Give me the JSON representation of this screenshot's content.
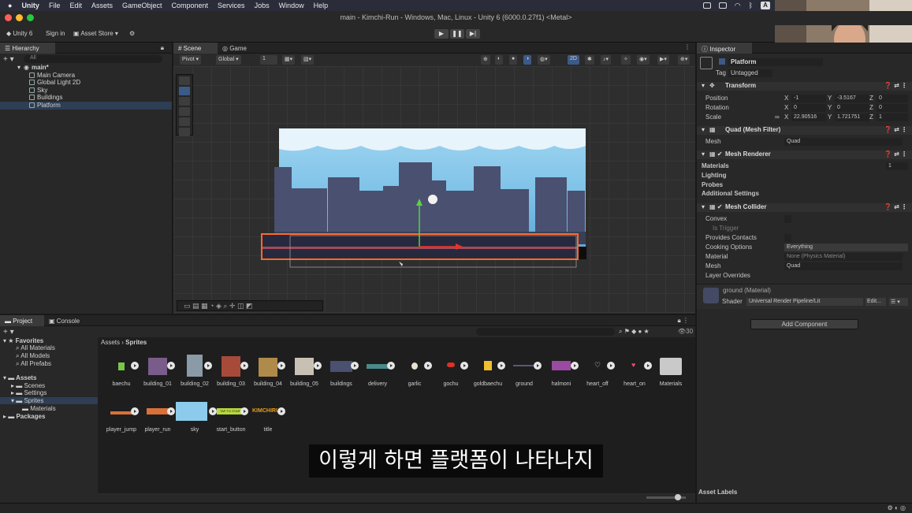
{
  "menubar": {
    "app": "Unity",
    "items": [
      "File",
      "Edit",
      "Assets",
      "GameObject",
      "Component",
      "Services",
      "Jobs",
      "Window",
      "Help"
    ],
    "badge": "A"
  },
  "window": {
    "title": "main - Kimchi-Run - Windows, Mac, Linux - Unity 6 (6000.0.27f1) <Metal>"
  },
  "toolbar": {
    "account": "Unity 6",
    "signin": "Sign in",
    "store": "Asset Store ▾"
  },
  "hierarchy": {
    "tab": "Hierarchy",
    "search": "All",
    "scene": "main*",
    "items": [
      "Main Camera",
      "Global Light 2D",
      "Sky",
      "Buildings",
      "Platform"
    ],
    "selected": 4
  },
  "scene": {
    "tabs": [
      "Scene",
      "Game"
    ],
    "pivot": "Pivot ▾",
    "global": "Global ▾",
    "snap": "1",
    "mode2d": "2D"
  },
  "inspector": {
    "tab": "Inspector",
    "object": "Platform",
    "tag_label": "Tag",
    "tag": "Untagged",
    "transform": {
      "title": "Transform",
      "position": {
        "label": "Position",
        "x": "-1",
        "y": "-3.5167",
        "z": "0"
      },
      "rotation": {
        "label": "Rotation",
        "x": "0",
        "y": "0",
        "z": "0"
      },
      "scale": {
        "label": "Scale",
        "x": "22.90516",
        "y": "1.721751",
        "z": "1"
      }
    },
    "meshfilter": {
      "title": "Quad (Mesh Filter)",
      "mesh_label": "Mesh",
      "mesh": "Quad"
    },
    "meshrenderer": {
      "title": "Mesh Renderer",
      "materials": "Materials",
      "materials_count": "1",
      "lighting": "Lighting",
      "probes": "Probes",
      "additional": "Additional Settings"
    },
    "collider": {
      "title": "Mesh Collider",
      "convex": "Convex",
      "trigger": "Is Trigger",
      "contacts": "Provides Contacts",
      "cooking_label": "Cooking Options",
      "cooking": "Everything",
      "material_label": "Material",
      "material": "None (Physics Material)",
      "mesh_label": "Mesh",
      "mesh": "Quad",
      "overrides": "Layer Overrides"
    },
    "material": {
      "name": "ground (Material)",
      "shader_label": "Shader",
      "shader": "Universal Render Pipeline/Lit",
      "edit": "Edit...",
      "dropdown": "☰ ▾"
    },
    "add_component": "Add Component",
    "asset_labels": "Asset Labels"
  },
  "project": {
    "tabs": [
      "Project",
      "Console"
    ],
    "count": "30",
    "breadcrumb": [
      "Assets",
      "Sprites"
    ],
    "tree": {
      "favorites": "Favorites",
      "fav_items": [
        "All Materials",
        "All Models",
        "All Prefabs"
      ],
      "assets": "Assets",
      "asset_items": [
        "Scenes",
        "Settings",
        "Sprites",
        "Materials"
      ],
      "packages": "Packages"
    },
    "assets_row1": [
      "baechu",
      "building_01",
      "building_02",
      "building_03",
      "building_04",
      "building_05",
      "buildings",
      "delivery",
      "garlic",
      "gochu",
      "goldbaechu",
      "ground",
      "halmoni",
      "heart_off",
      "heart_on",
      "Materials"
    ],
    "assets_row2": [
      "player_jump",
      "player_run",
      "sky",
      "start_button",
      "title"
    ],
    "start_label": "TAP TO START",
    "title_label": "KIMCHIRUN"
  },
  "subtitle": "이렇게 하면 플랫폼이 나타나지",
  "colors": {
    "accent": "#3c5a87",
    "selection_orange": "#ff6a2a",
    "sky": "#7fc3e8",
    "building": "#4a5070"
  }
}
